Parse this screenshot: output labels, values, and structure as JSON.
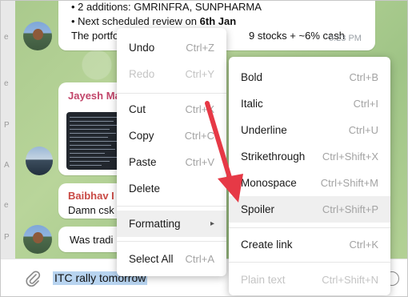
{
  "left_strip": {
    "marks": [
      "e",
      "e",
      "P",
      "A",
      "e",
      "P"
    ]
  },
  "messages": {
    "top": {
      "line1": "• 2 additions: GMRINFRA, SUNPHARMA",
      "line2_prefix": "• Next scheduled review on ",
      "line2_bold": "6th Jan",
      "line3": "The portfo",
      "line3_tail": "9 stocks + ~6% cash",
      "time": "9:23 PM"
    },
    "jayesh": {
      "sender": "Jayesh Ma"
    },
    "baibhav": {
      "sender": "Baibhav I",
      "text": "Damn csk"
    },
    "last": {
      "text": "Was tradi"
    }
  },
  "composer": {
    "text": "ITC rally tomorrow"
  },
  "context_menu": {
    "items": [
      {
        "label": "Undo",
        "shortcut": "Ctrl+Z",
        "disabled": false
      },
      {
        "label": "Redo",
        "shortcut": "Ctrl+Y",
        "disabled": true
      },
      {
        "label": "Cut",
        "shortcut": "Ctrl+X",
        "disabled": false
      },
      {
        "label": "Copy",
        "shortcut": "Ctrl+C",
        "disabled": false
      },
      {
        "label": "Paste",
        "shortcut": "Ctrl+V",
        "disabled": false
      },
      {
        "label": "Delete",
        "shortcut": "",
        "disabled": false
      },
      {
        "label": "Formatting",
        "shortcut": "▸",
        "disabled": false
      },
      {
        "label": "Select All",
        "shortcut": "Ctrl+A",
        "disabled": false
      }
    ]
  },
  "formatting_menu": {
    "items": [
      {
        "label": "Bold",
        "shortcut": "Ctrl+B",
        "disabled": false
      },
      {
        "label": "Italic",
        "shortcut": "Ctrl+I",
        "disabled": false
      },
      {
        "label": "Underline",
        "shortcut": "Ctrl+U",
        "disabled": false
      },
      {
        "label": "Strikethrough",
        "shortcut": "Ctrl+Shift+X",
        "disabled": false
      },
      {
        "label": "Monospace",
        "shortcut": "Ctrl+Shift+M",
        "disabled": false
      },
      {
        "label": "Spoiler",
        "shortcut": "Ctrl+Shift+P",
        "disabled": false
      },
      {
        "label": "Create link",
        "shortcut": "Ctrl+K",
        "disabled": false
      },
      {
        "label": "Plain text",
        "shortcut": "Ctrl+Shift+N",
        "disabled": true
      }
    ]
  },
  "colors": {
    "accent_arrow": "#e63946",
    "jayesh_name": "#c2456a",
    "baibhav_name": "#c94a45",
    "selection": "#b8d4f0"
  }
}
